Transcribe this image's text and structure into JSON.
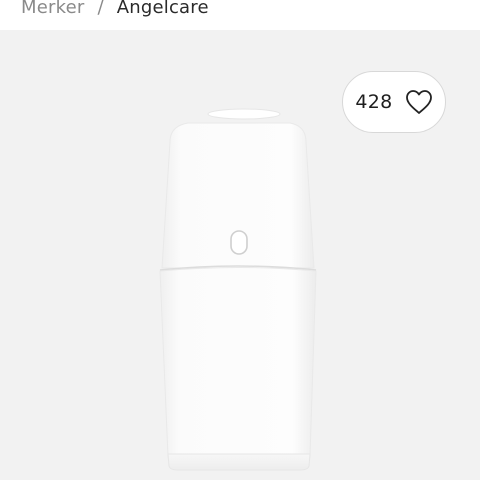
{
  "breadcrumb": {
    "items": [
      "Merker",
      "Angelcare"
    ],
    "separator": "/"
  },
  "like": {
    "count": "428",
    "icon": "heart-outline-icon"
  },
  "product": {
    "image": "diaper-disposal-bin",
    "colors": {
      "panel_background": "#f2f2f2",
      "product_body": "#fbfbfb"
    }
  }
}
